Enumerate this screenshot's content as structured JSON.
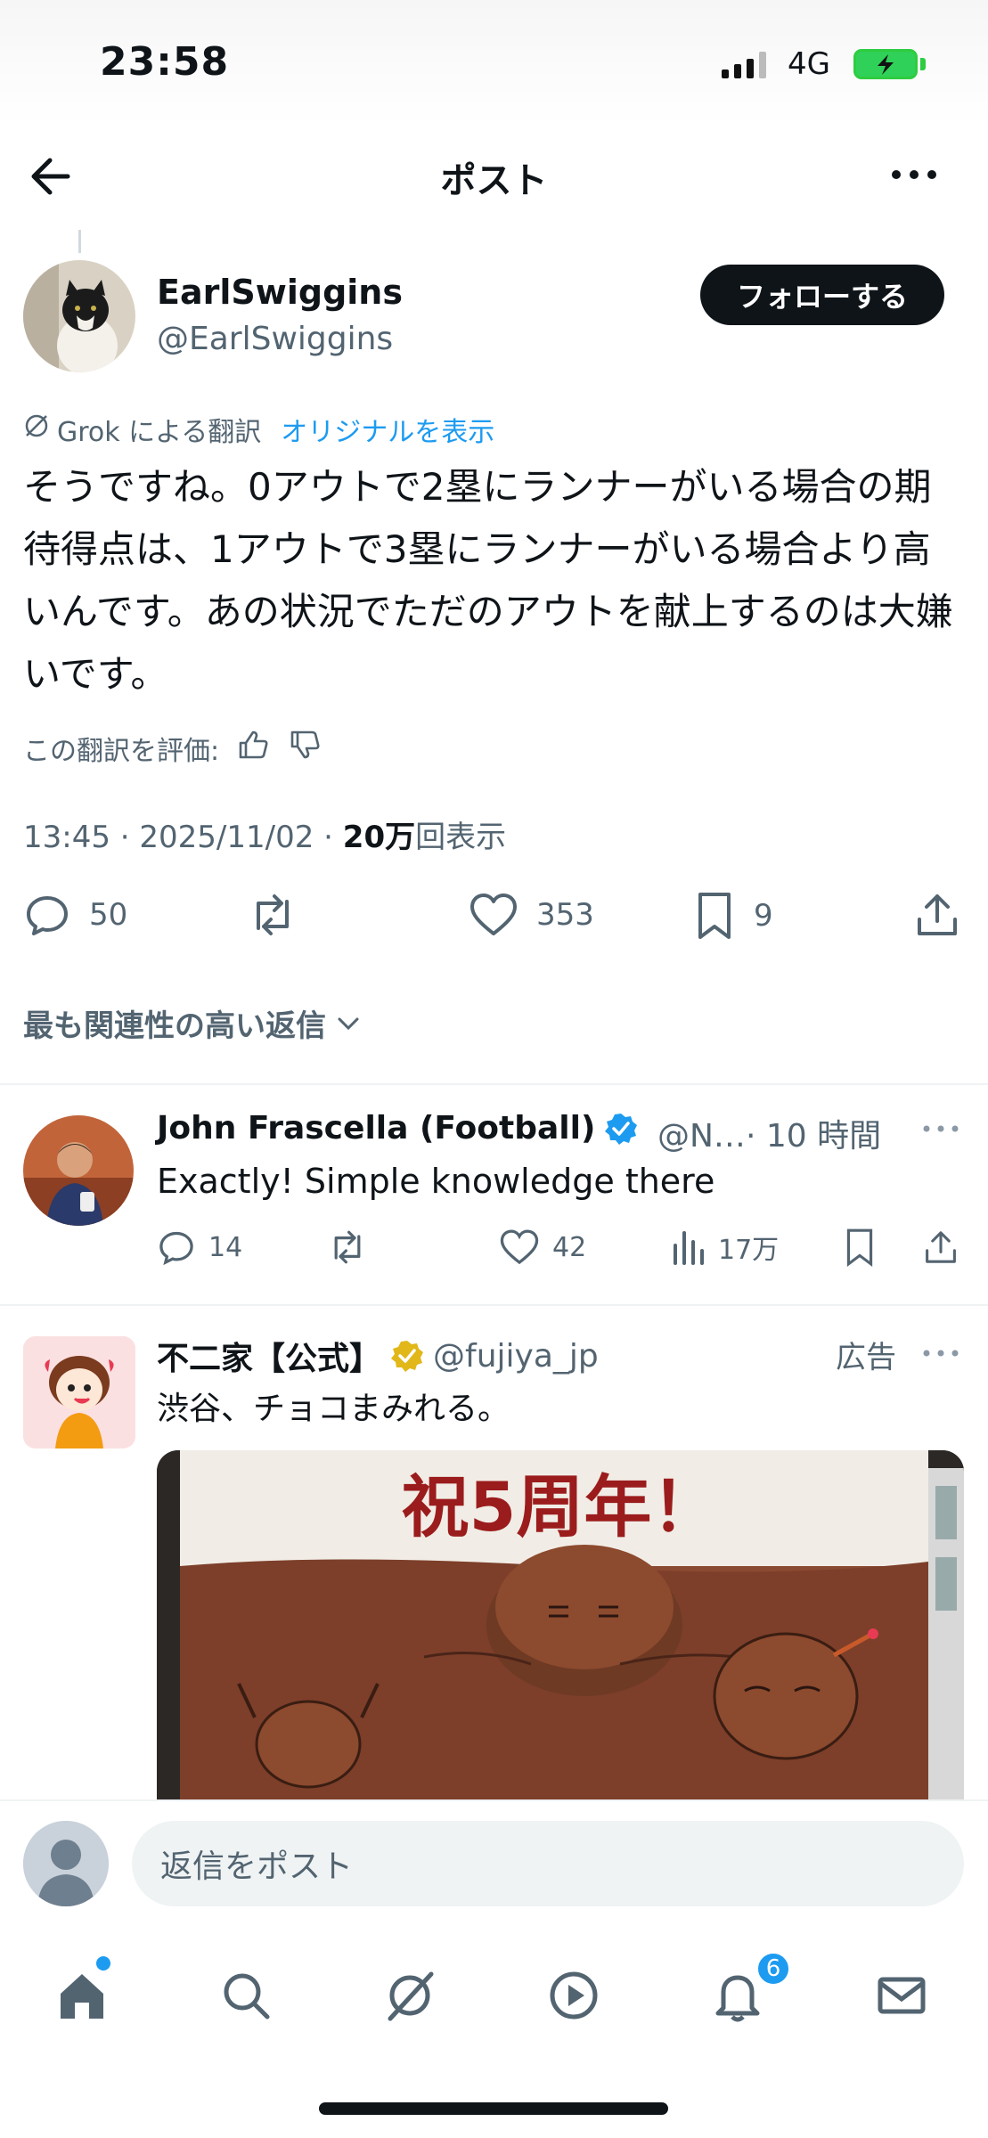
{
  "status_bar": {
    "time": "23:58",
    "network": "4G"
  },
  "header": {
    "title": "ポスト"
  },
  "post": {
    "author_name": "EarlSwiggins",
    "author_handle": "@EarlSwiggins",
    "follow_label": "フォローする",
    "translation_source": "Grok による翻訳",
    "show_original": "オリジナルを表示",
    "text": "そうですね。0アウトで2塁にランナーがいる場合の期待得点は、1アウトで3塁にランナーがいる場合より高いんです。あの状況でただのアウトを献上するのは大嫌いです。",
    "rate_label": "この翻訳を評価:",
    "timestamp": "13:45 · 2025/11/02 · ",
    "views_count": "20万",
    "views_label": "回表示",
    "replies": "50",
    "reposts": "",
    "likes": "353",
    "bookmarks": "9"
  },
  "sort": {
    "label": "最も関連性の高い返信"
  },
  "reply": {
    "name": "John Frascella (Football)",
    "handle": "@N…",
    "time": "· 10 時間",
    "text": "Exactly! Simple knowledge there",
    "replies": "14",
    "likes": "42",
    "views": "17万"
  },
  "ad": {
    "name": "不二家【公式】",
    "handle": "@fujiya_jp",
    "label": "広告",
    "text": "渋谷、チョコまみれる。",
    "image_text": "祝5周年！"
  },
  "composer": {
    "placeholder": "返信をポスト"
  },
  "tabbar": {
    "notification_count": "6"
  },
  "colors": {
    "accent": "#1d9bf0",
    "text": "#0f1419",
    "muted": "#536471",
    "verified": "#1d9bf0",
    "gold": "#e2b719"
  },
  "icons": [
    "back-icon",
    "more-icon",
    "grok-icon",
    "thumbs-up-icon",
    "thumbs-down-icon",
    "reply-icon",
    "repost-icon",
    "like-icon",
    "bookmark-icon",
    "share-icon",
    "views-icon",
    "home-icon",
    "search-icon",
    "grok-tab-icon",
    "video-icon",
    "notifications-icon",
    "messages-icon"
  ]
}
